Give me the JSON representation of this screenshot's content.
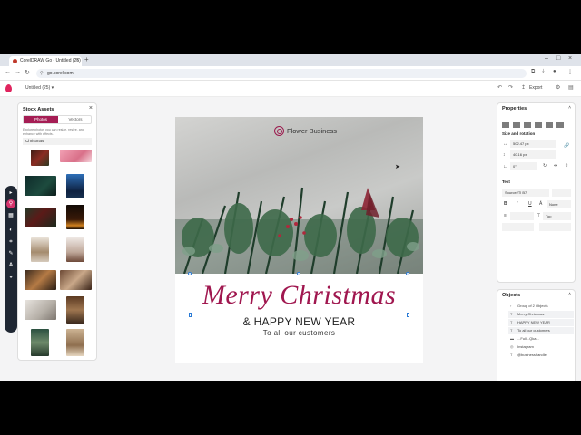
{
  "browser": {
    "tab_title": "CorelDRAW Go - Untitled (25)",
    "url": "go.corel.com"
  },
  "app": {
    "doc_title": "Untitled (25)",
    "export_label": "Export"
  },
  "assets": {
    "title": "Stock Assets",
    "tab_photos": "Photos",
    "tab_vectors": "Vectors",
    "description": "Explore photos you can resize, resize, and enhance with effects.",
    "search_value": "Christmas"
  },
  "card": {
    "brand": "Flower Business",
    "headline": "Merry Christmas",
    "subhead": "& HAPPY NEW YEAR",
    "line": "To  all our customers"
  },
  "properties": {
    "title": "Properties",
    "size_rotation_label": "Size and rotation",
    "width_value": "502.47 px",
    "height_value": "40.16 px",
    "rotation_value": "0°",
    "text_label": "Text",
    "font_value": "Source2Tl B7",
    "align_value": "None",
    "valign_value": "Top"
  },
  "objects": {
    "title": "Objects",
    "items": [
      "Group of 2 Objects",
      "Merry Christmas",
      "HAPPY NEW YEAR",
      "To  all our customers",
      "...Full...Qka...",
      "Instagram",
      "@businesshandle"
    ]
  },
  "colors": {
    "accent": "#a51d54",
    "headline": "#a0174f",
    "toolbar": "#1f2733"
  }
}
